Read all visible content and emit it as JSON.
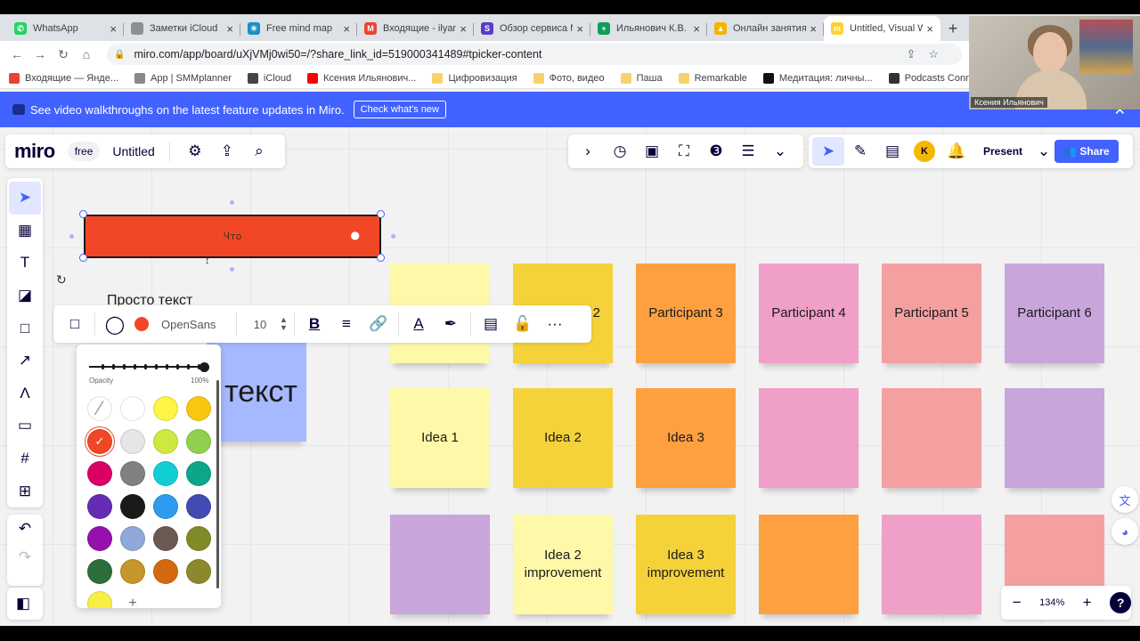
{
  "browser": {
    "tabs": [
      {
        "title": "WhatsApp",
        "color": "#25d366",
        "glyph": "✆"
      },
      {
        "title": "Заметки iCloud",
        "color": "#8e8e93",
        "glyph": ""
      },
      {
        "title": "Free mind map",
        "color": "#1a8fc9",
        "glyph": "✳"
      },
      {
        "title": "Входящие - ilyan",
        "color": "#ea4335",
        "glyph": "M"
      },
      {
        "title": "Обзор сервиса M",
        "color": "#5b3cc4",
        "glyph": "S"
      },
      {
        "title": "Ильянович К.В. I",
        "color": "#0f9d58",
        "glyph": "+"
      },
      {
        "title": "Онлайн занятия",
        "color": "#f4b400",
        "glyph": "▲"
      },
      {
        "title": "Untitled, Visual W",
        "color": "#ffd02f",
        "glyph": "m"
      }
    ],
    "url": "miro.com/app/board/uXjVMj0wi50=/?share_link_id=519000341489#tpicker-content",
    "bookmarks": [
      {
        "label": "Входящие — Янде...",
        "color": "#e94235"
      },
      {
        "label": "App | SMMplanner",
        "color": "#888888"
      },
      {
        "label": "iCloud",
        "color": "#444444"
      },
      {
        "label": "Ксения Ильянович...",
        "color": "#ff0000"
      },
      {
        "label": "Цифровизация",
        "color": "#f6d36a"
      },
      {
        "label": "Фото, видео",
        "color": "#f6d36a"
      },
      {
        "label": "Паша",
        "color": "#f6d36a"
      },
      {
        "label": "Remarkable",
        "color": "#f6d36a"
      },
      {
        "label": "Медитация: личны...",
        "color": "#111111"
      },
      {
        "label": "Podcasts Connect",
        "color": "#333333"
      }
    ]
  },
  "video": {
    "name": "Ксения Ильянович"
  },
  "banner": {
    "text": "See video walkthroughs on the latest feature updates in Miro.",
    "cta": "Check what's new"
  },
  "header": {
    "logo": "miro",
    "plan": "free",
    "board_title": "Untitled",
    "present": "Present",
    "share": "Share",
    "avatar": "K"
  },
  "shape": {
    "text": "Что"
  },
  "canvas_texts": {
    "plain": "Просто текст",
    "big": "текст"
  },
  "toolbar": {
    "font": "OpenSans",
    "font_size": "10"
  },
  "palette": {
    "opacity_label": "Opacity",
    "opacity_value": "100%",
    "swatches": [
      "#ffffff",
      "#ffffff",
      "#fef445",
      "#fac710",
      "#f24726",
      "#e6e6e6",
      "#cee741",
      "#8fd14f",
      "#da0063",
      "#808080",
      "#12cdd4",
      "#0ca789",
      "#652cb3",
      "#1a1a1a",
      "#2d9bf0",
      "#414bb2",
      "#9510ac",
      "#8fa8d8",
      "#6b5a52",
      "#808a27",
      "#2b6e3c",
      "#c4962c",
      "#d3690f",
      "#8a8a2c",
      "#f8ef44"
    ],
    "add": "+"
  },
  "notes": [
    {
      "text": "",
      "color": "#fef9a8"
    },
    {
      "text": "2",
      "color": "#f5d23a"
    },
    {
      "text": "Participant 3",
      "color": "#ffa040"
    },
    {
      "text": "Participant 4",
      "color": "#f0a0c8"
    },
    {
      "text": "Participant 5",
      "color": "#f5a0a0"
    },
    {
      "text": "Participant 6",
      "color": "#c8a6dc"
    },
    {
      "text": "Idea 1",
      "color": "#fef9a8"
    },
    {
      "text": "Idea 2",
      "color": "#f5d23a"
    },
    {
      "text": "Idea 3",
      "color": "#ffa040"
    },
    {
      "text": "",
      "color": "#f0a0c8"
    },
    {
      "text": "",
      "color": "#f5a0a0"
    },
    {
      "text": "",
      "color": "#c8a6dc"
    },
    {
      "text": "",
      "color": "#c8a6dc"
    },
    {
      "text": "Idea 2\nimprovement",
      "color": "#fef9a8"
    },
    {
      "text": "Idea 3\nimprovement",
      "color": "#f5d23a"
    },
    {
      "text": "",
      "color": "#ffa040"
    },
    {
      "text": "",
      "color": "#f0a0c8"
    },
    {
      "text": "",
      "color": "#f5a0a0"
    }
  ],
  "zoom": {
    "level": "134%",
    "minus": "−",
    "plus": "+",
    "help": "?"
  }
}
